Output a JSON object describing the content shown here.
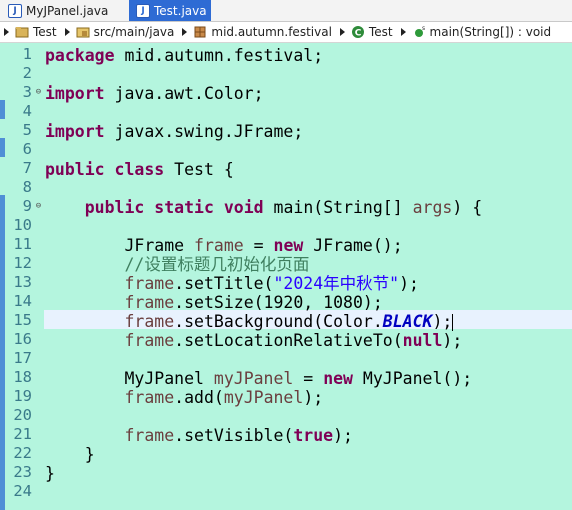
{
  "tabs": [
    {
      "label": "MyJPanel.java",
      "active": false
    },
    {
      "label": "Test.java",
      "active": true
    }
  ],
  "breadcrumb": [
    {
      "label": "Test",
      "icon": "project-icon"
    },
    {
      "label": "src/main/java",
      "icon": "source-folder-icon"
    },
    {
      "label": "mid.autumn.festival",
      "icon": "package-icon"
    },
    {
      "label": "Test",
      "icon": "class-icon"
    },
    {
      "label": "main(String[]) : void",
      "icon": "method-icon"
    }
  ],
  "line_numbers": [
    "1",
    "2",
    "3",
    "4",
    "5",
    "6",
    "7",
    "8",
    "9",
    "10",
    "11",
    "12",
    "13",
    "14",
    "15",
    "16",
    "17",
    "18",
    "19",
    "20",
    "21",
    "22",
    "23",
    "24"
  ],
  "code": {
    "l1_kw": "package",
    "l1_rest": " mid.autumn.festival;",
    "l3_kw": "import",
    "l3_rest": " java.awt.Color;",
    "l5_kw": "import",
    "l5_rest": " javax.swing.JFrame;",
    "l7_kw1": "public",
    "l7_kw2": "class",
    "l7_rest": " Test {",
    "l9_indent": "    ",
    "l9_kw1": "public",
    "l9_kw2": "static",
    "l9_kw3": "void",
    "l9_mid": " main(String[] ",
    "l9_var": "args",
    "l9_end": ") {",
    "l11_indent": "        ",
    "l11_a": "JFrame ",
    "l11_var": "frame",
    "l11_b": " = ",
    "l11_kw": "new",
    "l11_c": " JFrame();",
    "l12_indent": "        ",
    "l12_cmt": "//设置标题几初始化页面",
    "l13_indent": "        ",
    "l13_var": "frame",
    "l13_a": ".setTitle(",
    "l13_str": "\"2024年中秋节\"",
    "l13_b": ");",
    "l14_indent": "        ",
    "l14_var": "frame",
    "l14_a": ".setSize(1920, 1080);",
    "l15_indent": "        ",
    "l15_var": "frame",
    "l15_a": ".setBackground(Color.",
    "l15_stat": "BLACK",
    "l15_b": ");",
    "l16_indent": "        ",
    "l16_var": "frame",
    "l16_a": ".setLocationRelativeTo(",
    "l16_kw": "null",
    "l16_b": ");",
    "l18_indent": "        ",
    "l18_a": "MyJPanel ",
    "l18_var": "myJPanel",
    "l18_b": " = ",
    "l18_kw": "new",
    "l18_c": " MyJPanel();",
    "l19_indent": "        ",
    "l19_var": "frame",
    "l19_a": ".add(",
    "l19_var2": "myJPanel",
    "l19_b": ");",
    "l21_indent": "        ",
    "l21_var": "frame",
    "l21_a": ".setVisible(",
    "l21_kw": "true",
    "l21_b": ");",
    "l22_text": "    }",
    "l23_text": "}"
  },
  "colors": {
    "editor_bg": "#b4f5de",
    "keyword": "#7f0055",
    "string": "#2a00ff",
    "comment": "#3f7f5f",
    "active_tab": "#2e6bd4"
  }
}
